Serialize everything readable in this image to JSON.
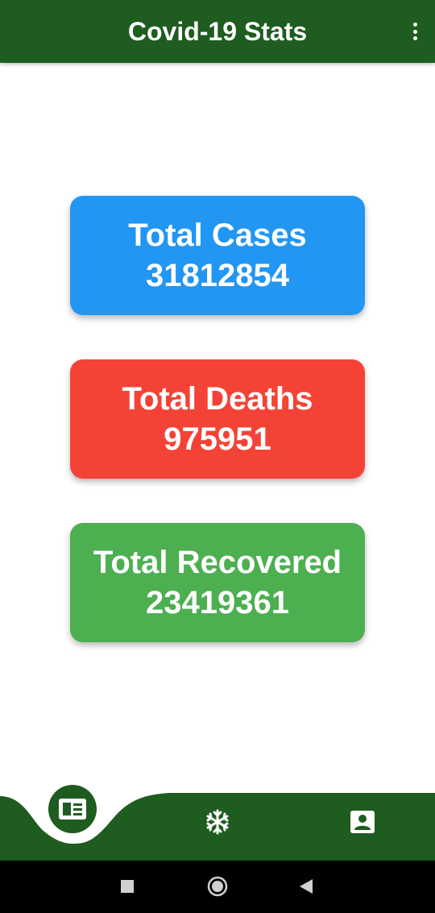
{
  "app_bar": {
    "title": "Covid-19 Stats",
    "menu_icon": "more-vert-icon"
  },
  "stats": {
    "cases": {
      "label": "Total Cases",
      "value": "31812854",
      "color": "#2196f3"
    },
    "deaths": {
      "label": "Total Deaths",
      "value": "975951",
      "color": "#f44336"
    },
    "recovered": {
      "label": "Total Recovered",
      "value": "23419361",
      "color": "#4caf50"
    }
  },
  "bottom_nav": {
    "color": "#1e5c20",
    "items": [
      {
        "icon": "news-icon",
        "active": true
      },
      {
        "icon": "virus-icon",
        "active": false
      },
      {
        "icon": "profile-icon",
        "active": false
      }
    ]
  },
  "system_nav": {
    "buttons": [
      "recents-icon",
      "home-icon",
      "back-icon"
    ]
  }
}
